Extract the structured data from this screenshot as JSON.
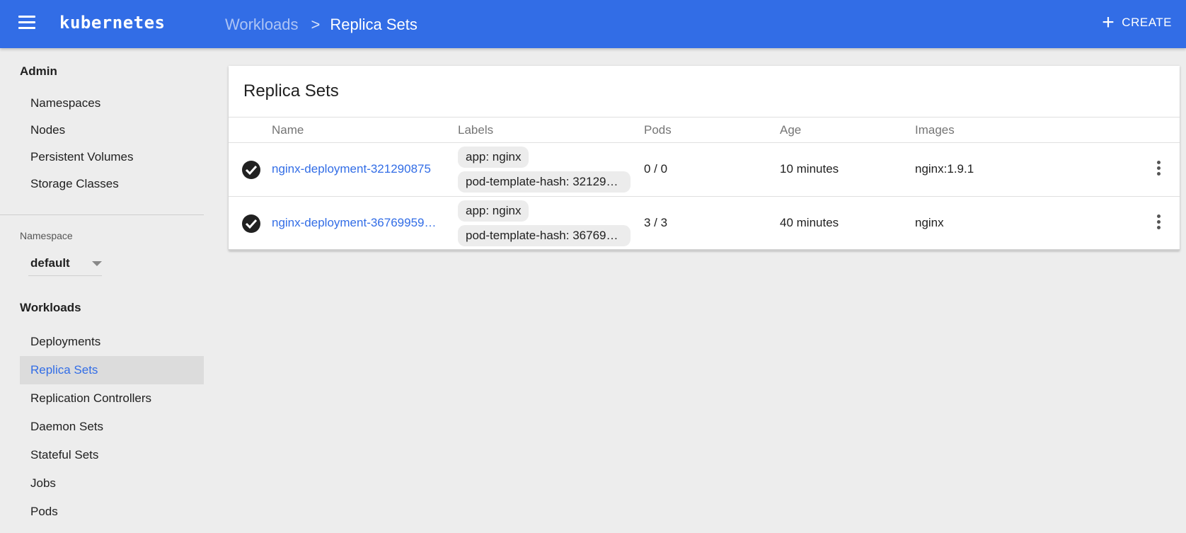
{
  "topbar": {
    "brand": "kubernetes",
    "breadcrumb_parent": "Workloads",
    "breadcrumb_separator": ">",
    "breadcrumb_current": "Replica Sets",
    "create_label": "CREATE",
    "accent_color": "#326de6"
  },
  "sidebar": {
    "admin_heading": "Admin",
    "admin_items": [
      "Namespaces",
      "Nodes",
      "Persistent Volumes",
      "Storage Classes"
    ],
    "namespace_label": "Namespace",
    "namespace_value": "default",
    "workloads_heading": "Workloads",
    "workload_items": [
      "Deployments",
      "Replica Sets",
      "Replication Controllers",
      "Daemon Sets",
      "Stateful Sets",
      "Jobs",
      "Pods"
    ],
    "active_item": "Replica Sets"
  },
  "card": {
    "title": "Replica Sets",
    "columns": [
      "Name",
      "Labels",
      "Pods",
      "Age",
      "Images"
    ],
    "rows": [
      {
        "status": "check-circle-icon",
        "name": "nginx-deployment-321290875",
        "labels": [
          "app: nginx",
          "pod-template-hash: 32129…"
        ],
        "pods": "0 / 0",
        "age": "10 minutes",
        "images": "nginx:1.9.1"
      },
      {
        "status": "check-circle-icon",
        "name": "nginx-deployment-36769959…",
        "labels": [
          "app: nginx",
          "pod-template-hash: 36769…"
        ],
        "pods": "3 / 3",
        "age": "40 minutes",
        "images": "nginx"
      }
    ]
  }
}
